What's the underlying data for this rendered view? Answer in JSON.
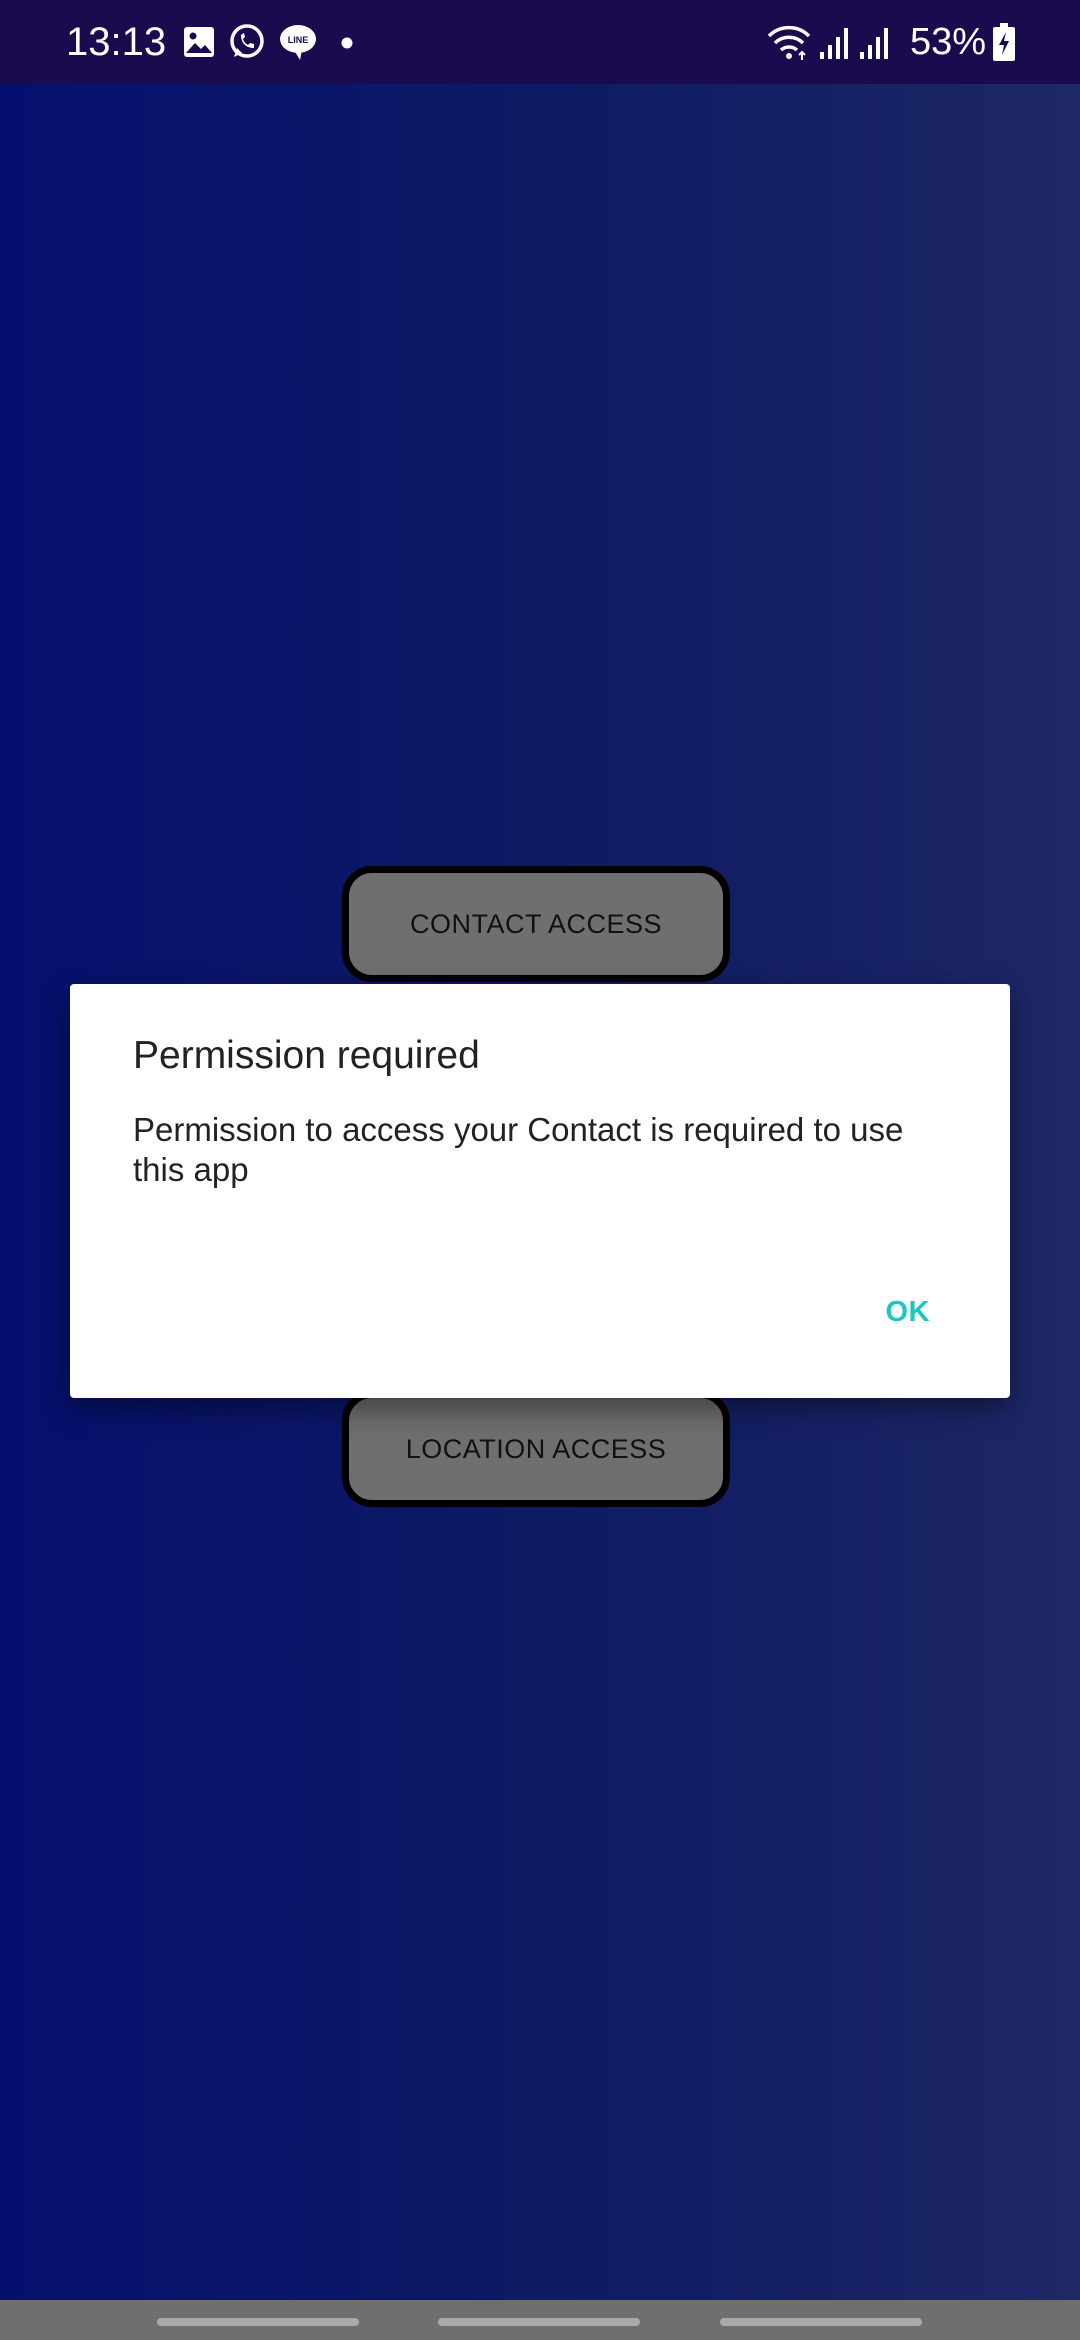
{
  "status_bar": {
    "time": "13:13",
    "battery": "53%",
    "notification_icons": [
      "image-icon",
      "whatsapp-icon",
      "line-icon",
      "dot-icon"
    ],
    "system_icons": [
      "wifi-icon",
      "signal-icon",
      "signal-icon",
      "battery-charging-icon"
    ]
  },
  "main": {
    "contact_button_label": "CONTACT ACCESS",
    "location_button_label": "LOCATION ACCESS"
  },
  "dialog": {
    "title": "Permission required",
    "message": "Permission to access your Contact is required to use this app",
    "ok_label": "OK"
  },
  "colors": {
    "status_bar": "#1a0a4e",
    "background_start": "#05106e",
    "background_end": "#1e2866",
    "button_fill": "#6f6f6f",
    "button_border": "#000000",
    "dialog_accent": "#1fc6c0"
  }
}
